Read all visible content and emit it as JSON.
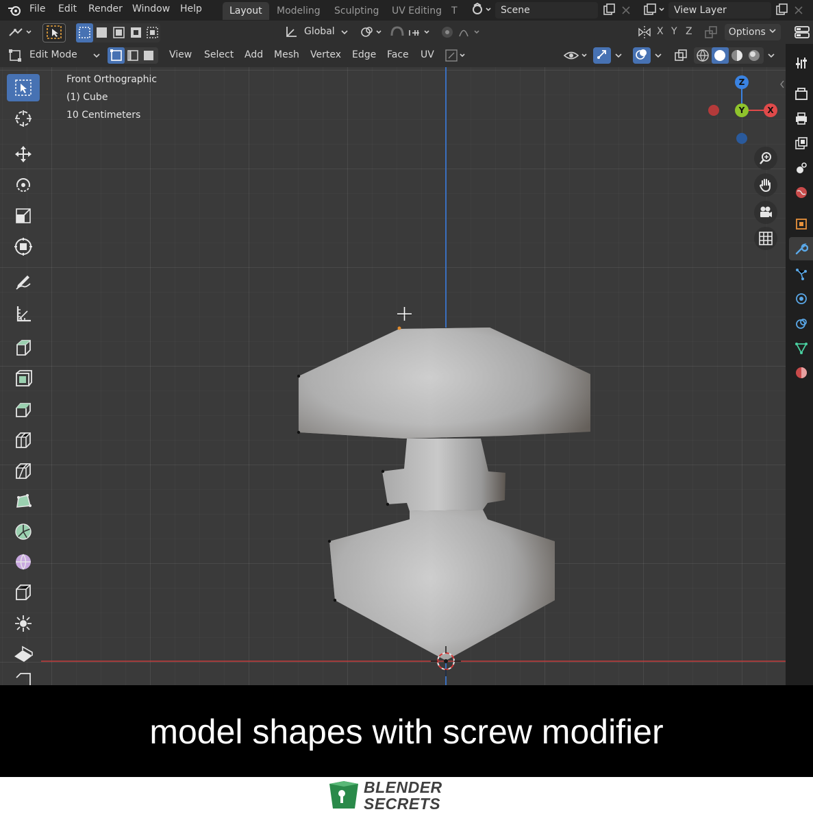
{
  "menubar": {
    "items": [
      "File",
      "Edit",
      "Render",
      "Window",
      "Help"
    ],
    "workspaces": [
      {
        "label": "Layout",
        "active": true
      },
      {
        "label": "Modeling",
        "active": false
      },
      {
        "label": "Sculpting",
        "active": false
      },
      {
        "label": "UV Editing",
        "active": false
      },
      {
        "label": "T",
        "active": false
      }
    ],
    "scene_value": "Scene",
    "view_layer_value": "View Layer"
  },
  "header": {
    "transform_orientation": "Global",
    "axis_x": "X",
    "axis_y": "Y",
    "axis_z": "Z",
    "options_label": "Options",
    "mode_label": "Edit Mode",
    "menus": [
      "View",
      "Select",
      "Add",
      "Mesh",
      "Vertex",
      "Edge",
      "Face",
      "UV"
    ]
  },
  "viewport": {
    "view_name": "Front Orthographic",
    "object_name": "(1) Cube",
    "scale_label": "10 Centimeters",
    "gizmo": {
      "z": "Z",
      "y": "Y",
      "x": "X"
    }
  },
  "caption": {
    "text": "model shapes with screw modifier"
  },
  "logo": {
    "line1": "BLENDER",
    "line2": "SECRETS"
  },
  "colors": {
    "accent": "#4772b3",
    "x_axis": "#e04a4a",
    "y_axis": "#8fc42c",
    "z_axis": "#3a83e2"
  }
}
